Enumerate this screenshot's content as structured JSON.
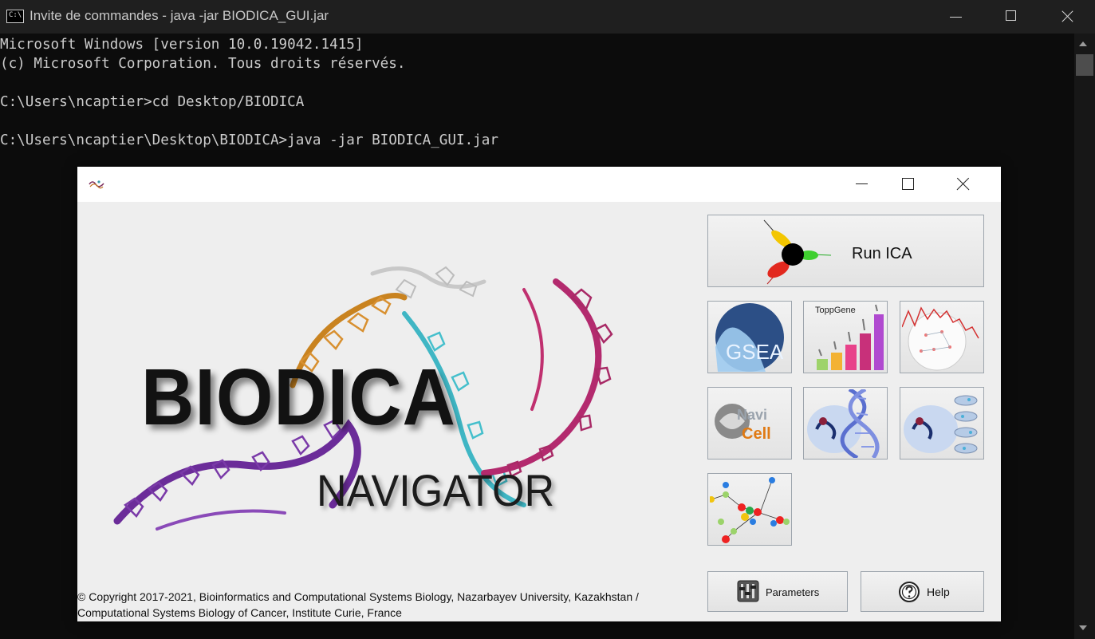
{
  "console": {
    "title": "Invite de commandes - java  -jar BIODICA_GUI.jar",
    "app_icon_text": "C:\\",
    "lines": [
      "Microsoft Windows [version 10.0.19042.1415]",
      "(c) Microsoft Corporation. Tous droits réservés.",
      "",
      "C:\\Users\\ncaptier>cd Desktop/BIODICA",
      "",
      "C:\\Users\\ncaptier\\Desktop\\BIODICA>java -jar BIODICA_GUI.jar"
    ]
  },
  "biodica": {
    "logo_title": "BIODICA",
    "logo_subtitle": "NAVIGATOR",
    "run_ica_label": "Run ICA",
    "tools": {
      "gsea_text": "GSEA",
      "toppgene_text": "ToppGene",
      "navicell_text_1": "Navi",
      "navicell_text_2": "Cell"
    },
    "parameters_label": "Parameters",
    "help_label": "Help",
    "copyright_line1": "© Copyright 2017-2021, Bioinformatics and Computational Systems Biology, Nazarbayev University, Kazakhstan /",
    "copyright_line2": "Computational Systems Biology of Cancer, Institute Curie, France"
  },
  "colors": {
    "console_bg": "#0c0c0c",
    "console_text": "#cccccc",
    "window_bg": "#eeeeee",
    "gsea_blue": "#2c4f86",
    "button_border": "#9da5ad"
  }
}
